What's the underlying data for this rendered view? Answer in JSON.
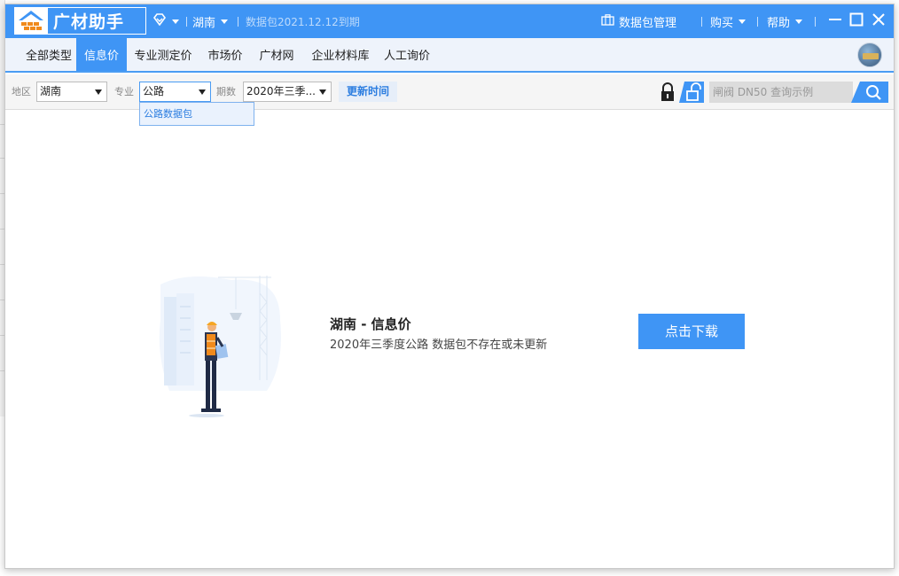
{
  "app": {
    "title": "广材助手",
    "region": "湖南",
    "package_expiry": "数据包2021.12.12到期",
    "package_manage": "数据包管理",
    "buy": "购买",
    "help": "帮助"
  },
  "nav": {
    "tabs": [
      {
        "label": "全部类型",
        "active": false
      },
      {
        "label": "信息价",
        "active": true
      },
      {
        "label": "专业测定价",
        "active": false
      },
      {
        "label": "市场价",
        "active": false
      },
      {
        "label": "广材网",
        "active": false
      },
      {
        "label": "企业材料库",
        "active": false
      },
      {
        "label": "人工询价",
        "active": false
      }
    ]
  },
  "filters": {
    "region_label": "地区",
    "region_value": "湖南",
    "specialty_label": "专业",
    "specialty_value": "公路",
    "period_label": "期数",
    "period_value": "2020年三季...",
    "update_time": "更新时间",
    "search_placeholder": "闸阀 DN50 查询示例",
    "dropdown_option": "公路数据包"
  },
  "empty_state": {
    "title": "湖南 - 信息价",
    "subtitle": "2020年三季度公路 数据包不存在或未更新",
    "download_button": "点击下载"
  },
  "colors": {
    "primary": "#3f95f5",
    "nav_bg": "#eef3fb",
    "filter_bg": "#f5f5f5"
  }
}
